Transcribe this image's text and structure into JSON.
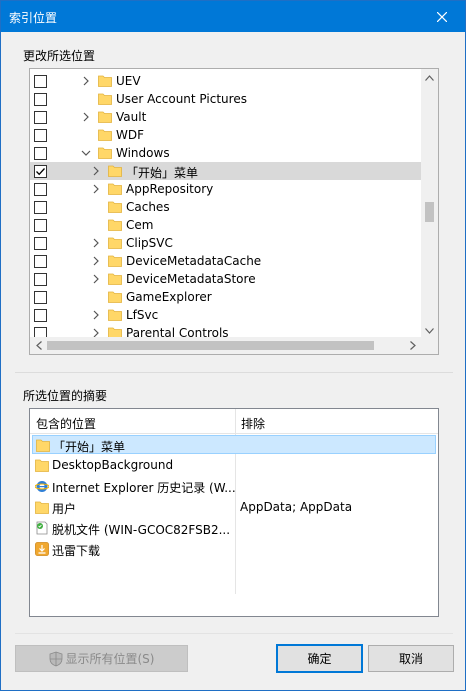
{
  "window": {
    "title": "索引位置"
  },
  "change_group": {
    "label": "更改所选位置"
  },
  "tree": {
    "rows": [
      {
        "label": "UEV",
        "checked": false,
        "expander": "collapsed",
        "indent": 0
      },
      {
        "label": "User Account Pictures",
        "checked": false,
        "expander": "none",
        "indent": 0
      },
      {
        "label": "Vault",
        "checked": false,
        "expander": "collapsed",
        "indent": 0
      },
      {
        "label": "WDF",
        "checked": false,
        "expander": "none",
        "indent": 0
      },
      {
        "label": "Windows",
        "checked": false,
        "expander": "expanded",
        "indent": 0
      },
      {
        "label": "「开始」菜单",
        "checked": true,
        "expander": "collapsed",
        "indent": 1,
        "selected": true
      },
      {
        "label": "AppRepository",
        "checked": false,
        "expander": "collapsed",
        "indent": 1
      },
      {
        "label": "Caches",
        "checked": false,
        "expander": "none",
        "indent": 1
      },
      {
        "label": "Cem",
        "checked": false,
        "expander": "none",
        "indent": 1
      },
      {
        "label": "ClipSVC",
        "checked": false,
        "expander": "collapsed",
        "indent": 1
      },
      {
        "label": "DeviceMetadataCache",
        "checked": false,
        "expander": "collapsed",
        "indent": 1
      },
      {
        "label": "DeviceMetadataStore",
        "checked": false,
        "expander": "collapsed",
        "indent": 1
      },
      {
        "label": "GameExplorer",
        "checked": false,
        "expander": "none",
        "indent": 1
      },
      {
        "label": "LfSvc",
        "checked": false,
        "expander": "collapsed",
        "indent": 1
      },
      {
        "label": "Parental Controls",
        "checked": false,
        "expander": "collapsed",
        "indent": 1
      }
    ]
  },
  "summary_group": {
    "label": "所选位置的摘要"
  },
  "summary": {
    "col_included": "包含的位置",
    "col_exclude": "排除",
    "rows": [
      {
        "location": "「开始」菜单",
        "exclude": "",
        "icon": "folder-icon",
        "selected": true
      },
      {
        "location": "DesktopBackground",
        "exclude": "",
        "icon": "folder-icon"
      },
      {
        "location": "Internet Explorer 历史记录 (W...",
        "exclude": "",
        "icon": "ie-icon"
      },
      {
        "location": "用户",
        "exclude": "AppData; AppData",
        "icon": "folder-icon"
      },
      {
        "location": "脱机文件 (WIN-GCOC82FSB2...",
        "exclude": "",
        "icon": "offline-files-icon"
      },
      {
        "location": "迅雷下载",
        "exclude": "",
        "icon": "download-icon"
      }
    ]
  },
  "buttons": {
    "show_all": "显示所有位置(S)",
    "ok": "确定",
    "cancel": "取消"
  },
  "colors": {
    "titlebar": "#0078d7",
    "folder": "#ffd768",
    "selection": "#cce8ff"
  }
}
